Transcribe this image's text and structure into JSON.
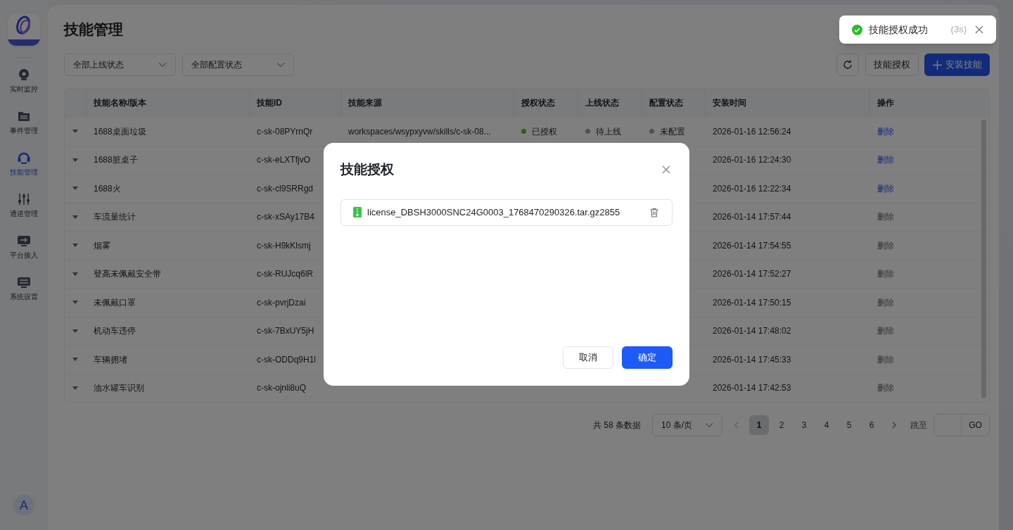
{
  "sidebar": {
    "items": [
      {
        "label": "实时监控",
        "kind": "camera",
        "selected": false
      },
      {
        "label": "事件管理",
        "kind": "folder",
        "selected": false
      },
      {
        "label": "技能管理",
        "kind": "headset",
        "selected": true
      },
      {
        "label": "通道管理",
        "kind": "sliders",
        "selected": false
      },
      {
        "label": "平台接入",
        "kind": "access",
        "selected": false
      },
      {
        "label": "系统设置",
        "kind": "settings",
        "selected": false
      }
    ],
    "avatar": "A"
  },
  "page": {
    "title": "技能管理"
  },
  "filters": [
    {
      "label": "全部上线状态"
    },
    {
      "label": "全部配置状态"
    }
  ],
  "toolbar": {
    "authorize_button": "技能授权",
    "install_button": "安装技能"
  },
  "table": {
    "columns": [
      "技能名称/版本",
      "技能ID",
      "技能来源",
      "授权状态",
      "上线状态",
      "配置状态",
      "安装时间",
      "操作"
    ],
    "rows": [
      {
        "name": "1688桌面垃圾",
        "id": "c-sk-08PYrnQr",
        "source": "workspaces/wsypxyvw/skills/c-sk-08...",
        "auth": {
          "label": "已授权",
          "color": "#29620d"
        },
        "online": {
          "label": "待上线",
          "color": "#4e5157"
        },
        "config": {
          "label": "未配置",
          "color": "#4e5157"
        },
        "time": "2026-01-16 12:56:24",
        "action": {
          "label": "删除",
          "disabled": false
        }
      },
      {
        "name": "1688脏桌子",
        "id": "c-sk-eLXTfjvO",
        "time": "2026-01-16 12:24:30",
        "action": {
          "label": "删除",
          "disabled": false
        }
      },
      {
        "name": "1688火",
        "id": "c-sk-cl9SRRgd",
        "time": "2026-01-16 12:22:34",
        "action": {
          "label": "删除",
          "disabled": false
        }
      },
      {
        "name": "车流量统计",
        "id": "c-sk-xSAy17B4",
        "time": "2026-01-14 17:57:44",
        "action": {
          "label": "删除",
          "disabled": true
        }
      },
      {
        "name": "烟雾",
        "id": "c-sk-H9kKlsmj",
        "time": "2026-01-14 17:54:55",
        "action": {
          "label": "删除",
          "disabled": true
        }
      },
      {
        "name": "登高未佩戴安全带",
        "id": "c-sk-RUJcq6lR",
        "time": "2026-01-14 17:52:27",
        "action": {
          "label": "删除",
          "disabled": true
        }
      },
      {
        "name": "未佩戴口罩",
        "id": "c-sk-pvrjDzai",
        "time": "2026-01-14 17:50:15",
        "action": {
          "label": "删除",
          "disabled": true
        }
      },
      {
        "name": "机动车违停",
        "id": "c-sk-7BxUY5jH",
        "time": "2026-01-14 17:48:02",
        "action": {
          "label": "删除",
          "disabled": true
        }
      },
      {
        "name": "车辆拥堵",
        "id": "c-sk-ODDq9H1l",
        "time": "2026-01-14 17:45:33",
        "action": {
          "label": "删除",
          "disabled": true
        }
      },
      {
        "name": "油水罐车识别",
        "id": "c-sk-ojnli8uQ",
        "time": "2026-01-14 17:42:53",
        "action": {
          "label": "删除",
          "disabled": true
        }
      }
    ]
  },
  "pagination": {
    "total": "共 58 条数据",
    "page_size": "10 条/页",
    "pages": [
      {
        "label": "1",
        "selected": true
      },
      {
        "label": "2",
        "selected": false
      },
      {
        "label": "3",
        "selected": false
      },
      {
        "label": "4",
        "selected": false
      },
      {
        "label": "5",
        "selected": false
      },
      {
        "label": "6",
        "selected": false
      }
    ],
    "jump_label": "跳至",
    "go": "GO"
  },
  "dialog": {
    "title": "技能授权",
    "file": "license_DBSH3000SNC24G0003_1768470290326.tar.gz2855",
    "buttons": [
      {
        "label": "取消",
        "kind": "secondary"
      },
      {
        "label": "确定",
        "kind": "primary"
      }
    ]
  },
  "toast": {
    "message": "技能授权成功",
    "countdown": "(3s)"
  }
}
